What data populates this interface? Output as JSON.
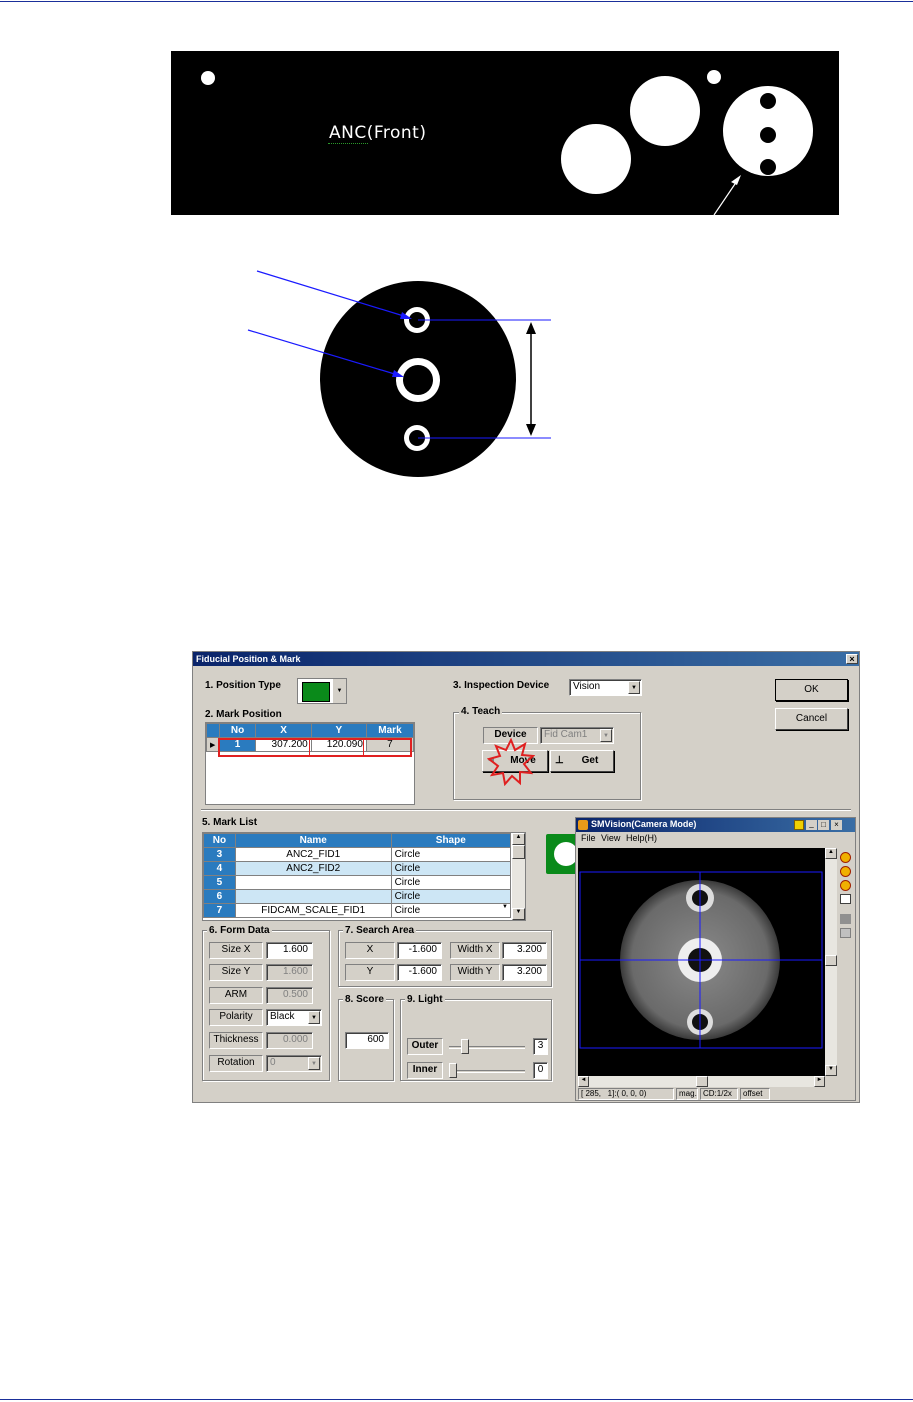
{
  "anc_label": "ANC(Front)",
  "dialog": {
    "title": "Fiducial Position & Mark",
    "position_type_label": "1. Position Type",
    "mark_position_label": "2. Mark Position",
    "mark_position_headers": [
      "No",
      "X",
      "Y",
      "Mark"
    ],
    "mark_position_row": {
      "no": "1",
      "x": "307.200",
      "y": "120.090",
      "mark": "7"
    },
    "inspection_device_label": "3. Inspection Device",
    "inspection_device_value": "Vision",
    "teach_label": "4. Teach",
    "device_label": "Device",
    "device_value": "Fid Cam1",
    "move_label": "Move",
    "get_label": "Get",
    "ok_label": "OK",
    "cancel_label": "Cancel",
    "mark_list_label": "5. Mark List",
    "mark_list_headers": [
      "No",
      "Name",
      "Shape"
    ],
    "mark_list_rows": [
      {
        "no": "3",
        "name": "ANC2_FID1",
        "shape": "Circle"
      },
      {
        "no": "4",
        "name": "ANC2_FID2",
        "shape": "Circle"
      },
      {
        "no": "5",
        "name": "",
        "shape": "Circle"
      },
      {
        "no": "6",
        "name": "",
        "shape": "Circle"
      },
      {
        "no": "7",
        "name": "FIDCAM_SCALE_FID1",
        "shape": "Circle"
      }
    ],
    "form_data_label": "6. Form Data",
    "size_x_label": "Size X",
    "size_x_value": "1.600",
    "size_y_label": "Size Y",
    "size_y_value": "1.600",
    "arm_label": "ARM",
    "arm_value": "0.500",
    "polarity_label": "Polarity",
    "polarity_value": "Black",
    "thickness_label": "Thickness",
    "thickness_value": "0.000",
    "rotation_label": "Rotation",
    "rotation_value": "0",
    "search_area_label": "7. Search Area",
    "sa_x_label": "X",
    "sa_x_value": "-1.600",
    "sa_width_x_label": "Width X",
    "sa_width_x_value": "3.200",
    "sa_y_label": "Y",
    "sa_y_value": "-1.600",
    "sa_width_y_label": "Width Y",
    "sa_width_y_value": "3.200",
    "score_label": "8. Score",
    "score_value": "600",
    "light_label": "9. Light",
    "outer_label": "Outer",
    "outer_value": "3",
    "inner_label": "Inner",
    "inner_value": "0"
  },
  "vision": {
    "title": "SMVision(Camera Mode)",
    "menu": [
      "File",
      "View",
      "Help(H)"
    ],
    "status_coords": "[ 285,   1]:( 0, 0, 0)",
    "status_mag": "mag.",
    "status_cd": "CD:1/2x",
    "status_offset": "offset"
  },
  "colors": {
    "rule": "#1a2f9a",
    "header_blue": "#2a7bbf",
    "highlight_red": "#e02020",
    "swatch_green": "#0a8a1a"
  }
}
